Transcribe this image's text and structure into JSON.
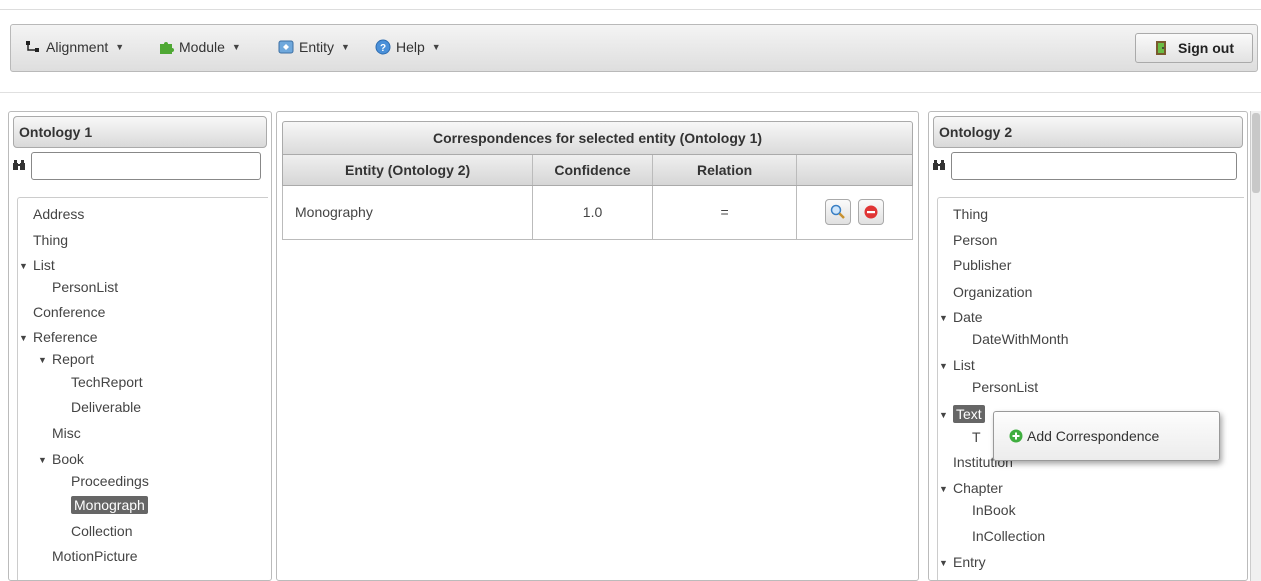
{
  "toolbar": {
    "menus": [
      {
        "label": "Alignment",
        "icon": "alignment-icon"
      },
      {
        "label": "Module",
        "icon": "puzzle-icon"
      },
      {
        "label": "Entity",
        "icon": "entity-icon"
      },
      {
        "label": "Help",
        "icon": "help-icon"
      }
    ],
    "signout_label": "Sign out"
  },
  "ontology1": {
    "title": "Ontology 1",
    "search_value": "",
    "tree": [
      {
        "label": "Address"
      },
      {
        "label": "Thing"
      },
      {
        "label": "List",
        "expanded": true
      },
      {
        "label": "PersonList"
      },
      {
        "label": "Conference"
      },
      {
        "label": "Reference",
        "expanded": true
      },
      {
        "label": "Report",
        "expanded": true
      },
      {
        "label": "TechReport"
      },
      {
        "label": "Deliverable"
      },
      {
        "label": "Misc"
      },
      {
        "label": "Book",
        "expanded": true
      },
      {
        "label": "Proceedings"
      },
      {
        "label": "Monograph",
        "selected": true
      },
      {
        "label": "Collection"
      },
      {
        "label": "MotionPicture"
      }
    ]
  },
  "correspondences": {
    "title": "Correspondences for selected entity (Ontology 1)",
    "columns": [
      "Entity (Ontology 2)",
      "Confidence",
      "Relation",
      ""
    ],
    "rows": [
      {
        "entity": "Monography",
        "confidence": "1.0",
        "relation": "="
      }
    ]
  },
  "ontology2": {
    "title": "Ontology 2",
    "search_value": "",
    "tree": [
      {
        "label": "Thing"
      },
      {
        "label": "Person"
      },
      {
        "label": "Publisher"
      },
      {
        "label": "Organization"
      },
      {
        "label": "Date",
        "expanded": true
      },
      {
        "label": "DateWithMonth"
      },
      {
        "label": "List",
        "expanded": true
      },
      {
        "label": "PersonList"
      },
      {
        "label": "Text",
        "expanded": true,
        "selected": true
      },
      {
        "label": "T"
      },
      {
        "label": "Institution"
      },
      {
        "label": "Chapter",
        "expanded": true
      },
      {
        "label": "InBook"
      },
      {
        "label": "InCollection"
      },
      {
        "label": "Entry",
        "expanded": true
      }
    ]
  },
  "context_menu": {
    "item_label": "Add Correspondence"
  },
  "colors": {
    "selected_bg": "#666666",
    "add_icon": "#3fae3f",
    "delete_icon": "#e03535"
  }
}
